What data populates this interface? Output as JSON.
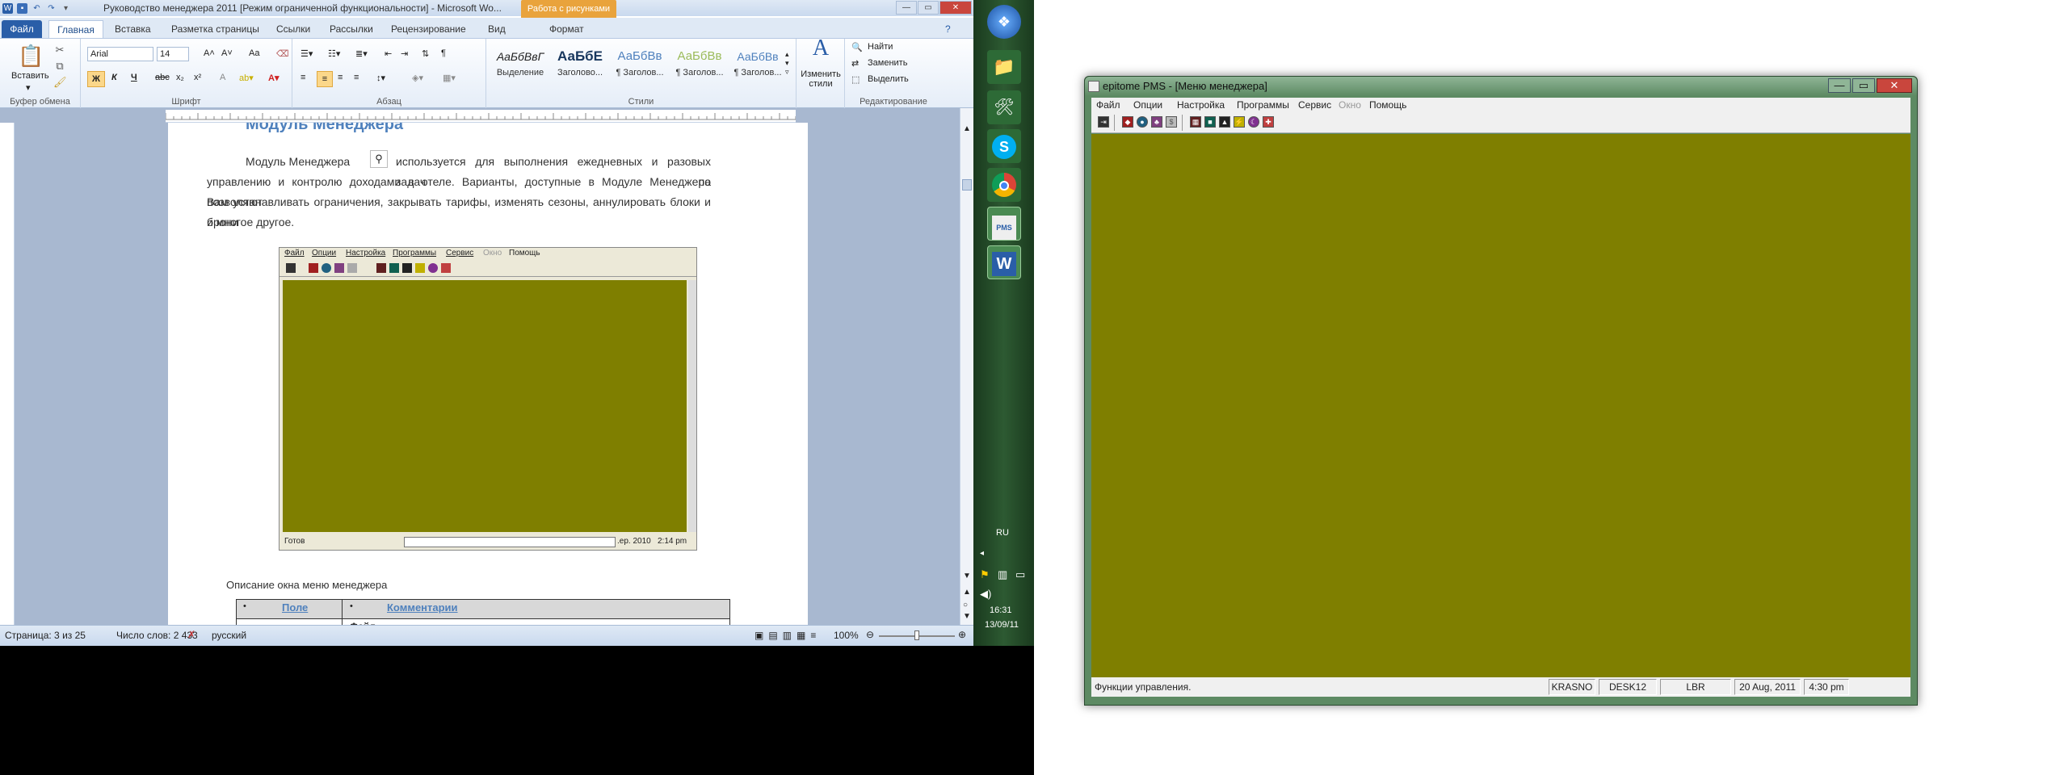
{
  "word": {
    "title": "Руководство менеджера 2011 [Режим ограниченной функциональности] - Microsoft Wo...",
    "context_tab_title": "Работа с рисунками",
    "tabs": [
      "Файл",
      "Главная",
      "Вставка",
      "Разметка страницы",
      "Ссылки",
      "Рассылки",
      "Рецензирование",
      "Вид",
      "Формат"
    ],
    "clipboard": {
      "paste": "Вставить",
      "label": "Буфер обмена"
    },
    "font": {
      "name": "Arial",
      "size": "14",
      "label": "Шрифт",
      "bold": "Ж",
      "italic": "К",
      "underline": "Ч",
      "strike": "abc",
      "sub": "x₂",
      "sup": "x²",
      "grow": "A˄",
      "shrink": "A˅",
      "case": "Aa"
    },
    "paragraph": {
      "label": "Абзац"
    },
    "styles": {
      "label": "Стили",
      "items": [
        {
          "preview": "АаБбВвГ",
          "name": "Выделение"
        },
        {
          "preview": "АаБбЕ",
          "name": "Заголово..."
        },
        {
          "preview": "АаБбВв",
          "name": "¶ Заголов..."
        },
        {
          "preview": "АаБбВв",
          "name": "¶ Заголов..."
        },
        {
          "preview": "АаБбВв",
          "name": "¶ Заголов..."
        }
      ],
      "change": "Изменить стили"
    },
    "editing": {
      "label": "Редактирование",
      "find": "Найти",
      "replace": "Заменить",
      "select": "Выделить"
    },
    "doc": {
      "heading": "Модуль Менеджера",
      "para_before_icon": "Модуль Менеджера",
      "para_line1_rest": "используется для выполнения ежедневных и разовых задач по",
      "para_line2": "управлению и контролю доходами в отеле. Варианты, доступные в Модуле Менеджера позволяют",
      "para_line3": "Вам устанавливать ограничения, закрывать тарифы, изменять сезоны, аннулировать блоки и брони",
      "para_line4": "и многое другое.",
      "caption": "Описание окна меню менеджера",
      "table_headers": [
        "Поле",
        "Комментарии"
      ],
      "table_next_row": "Файл"
    },
    "embedded": {
      "menu": [
        "Файл",
        "Опции",
        "Настройка",
        "Программы",
        "Сервис",
        "Окно",
        "Помощь"
      ],
      "status": [
        "Готов",
        "",
        ".ер. 2010",
        "2:14 pm"
      ]
    },
    "status": {
      "page": "Страница: 3 из 25",
      "words": "Число слов: 2 433",
      "lang": "русский",
      "zoom": "100%"
    }
  },
  "taskbar": {
    "lang": "RU",
    "time": "16:31",
    "date": "13/09/11"
  },
  "epitome": {
    "title": "epitome PMS - [Меню менеджера]",
    "menu": [
      "Файл",
      "Опции",
      "Настройка",
      "Программы",
      "Сервис",
      "Окно",
      "Помощь"
    ],
    "status": {
      "message": "Функции управления.",
      "panels": [
        "KRASNO",
        "DESK12",
        "LBR",
        "20 Aug, 2011",
        "4:30 pm"
      ]
    },
    "client_color": "#7f7f00"
  }
}
